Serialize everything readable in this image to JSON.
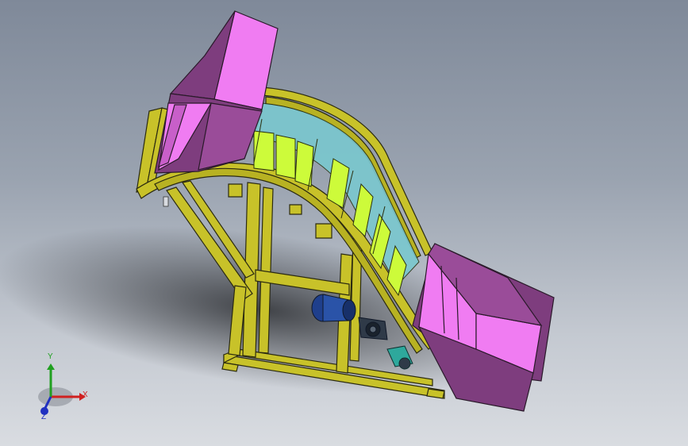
{
  "viewport": {
    "background_top": "#7f8999",
    "background_bottom": "#d9dce1"
  },
  "model": {
    "frame_color": "#c8c229",
    "frame_edge_color": "#2b2a10",
    "hopper_color": "#f07cf2",
    "hopper_shade_color": "#7e3d7e",
    "belt_color": "#cdfb3a",
    "glass_color": "#7ac8cf",
    "motor_color": "#1f3f8c",
    "gearbox_color": "#2f3a48",
    "bracket_color": "#2ea89c"
  },
  "triad": {
    "x_label": "X",
    "y_label": "Y",
    "z_label": "Z",
    "x_color": "#d02020",
    "y_color": "#20a020",
    "z_color": "#2030c0"
  }
}
